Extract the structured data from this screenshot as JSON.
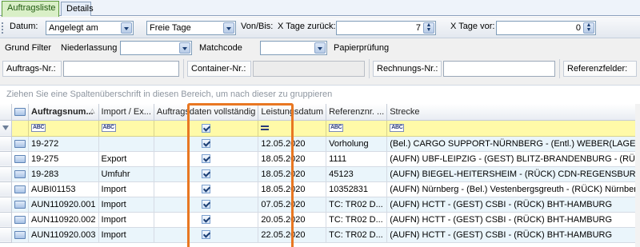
{
  "tabs": [
    {
      "label": "Auftragsliste",
      "active": true
    },
    {
      "label": "Details",
      "active": false
    }
  ],
  "filter": {
    "datum_label": "Datum:",
    "datum_value": "Angelegt am",
    "freie_tage_value": "Freie Tage",
    "von_bis_label": "Von/Bis:",
    "x_tage_zurueck_label": "X Tage zurück:",
    "x_tage_zurueck_value": "7",
    "x_tage_vor_label": "X Tage vor:",
    "x_tage_vor_value": "0",
    "grund_filter_label": "Grund Filter",
    "niederlassung_label": "Niederlassung",
    "matchcode_label": "Matchcode",
    "papierpruefung_label": "Papierprüfung",
    "auftrags_nr_label": "Auftrags-Nr.:",
    "container_nr_label": "Container-Nr.:",
    "rechnungs_nr_label": "Rechnungs-Nr.:",
    "referenzfelder_label": "Referenzfelder:"
  },
  "group_hint": "Ziehen Sie eine Spaltenüberschrift in diesen Bereich, um nach dieser zu gruppieren",
  "grid": {
    "columns": [
      "Auftragsnum...",
      "Import / Ex...",
      "Auftragsdaten vollständig",
      "Leistungsdatum",
      "Referenznr. ...",
      "Strecke"
    ],
    "rows": [
      {
        "auftrag": "19-272",
        "import": "",
        "datum": "12.05.2020",
        "ref": "Vorholung",
        "strecke": "(Bel.) CARGO SUPPORT-NÜRNBERG - (Entl.) WEBER(LAGER)-NÜ"
      },
      {
        "auftrag": "19-275",
        "import": "Export",
        "datum": "18.05.2020",
        "ref": "1111",
        "strecke": "(AUFN) UBF-LEIPZIG - (GEST) BLITZ-BRANDENBURG - (RÜCK) BH"
      },
      {
        "auftrag": "19-283",
        "import": "Umfuhr",
        "datum": "18.05.2020",
        "ref": "45123",
        "strecke": "(AUFN) BIEGEL-HEITERSHEIM - (RÜCK) CDN-REGENSBURG"
      },
      {
        "auftrag": "AUBI01153",
        "import": "Import",
        "datum": "18.05.2020",
        "ref": "10352831",
        "strecke": "(AUFN) Nürnberg - (Bel.) Vestenbergsgreuth - (RÜCK) Nürnberg"
      },
      {
        "auftrag": "AUN110920.001",
        "import": "Import",
        "datum": "07.05.2020",
        "ref": "TC: TR02 D...",
        "strecke": "(AUFN) HCTT - (GEST) CSBI - (RÜCK) BHT-HAMBURG"
      },
      {
        "auftrag": "AUN110920.002",
        "import": "Import",
        "datum": "20.05.2020",
        "ref": "TC: TR02 D...",
        "strecke": "(AUFN) HCTT - (GEST) CSBI - (RÜCK) BHT-HAMBURG"
      },
      {
        "auftrag": "AUN110920.003",
        "import": "Import",
        "datum": "22.05.2020",
        "ref": "TC: TR02 D...",
        "strecke": "(AUFN) HCTT - (GEST) CSBI - (RÜCK) BHT-HAMBURG"
      }
    ]
  },
  "colors": {
    "highlight": "#e87722",
    "filter_row": "#fffaa8",
    "alt_row": "#eaf5fb"
  }
}
